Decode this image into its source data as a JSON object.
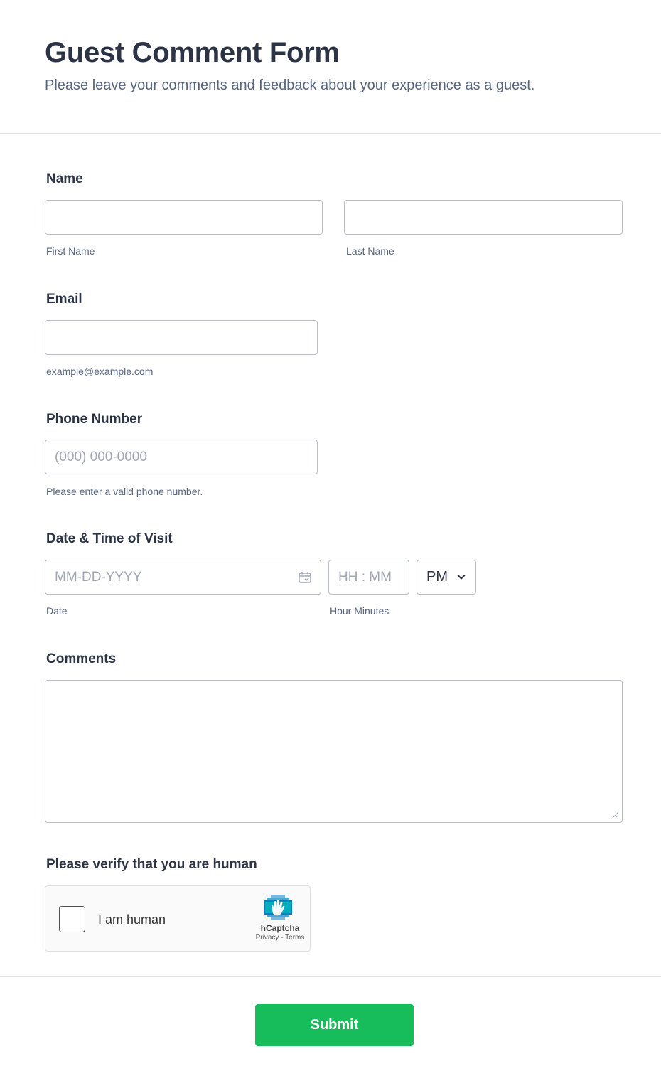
{
  "header": {
    "title": "Guest Comment Form",
    "subtitle": "Please leave your comments and feedback about your experience as a guest."
  },
  "name_field": {
    "label": "Name",
    "first": {
      "value": "",
      "sublabel": "First Name"
    },
    "last": {
      "value": "",
      "sublabel": "Last Name"
    }
  },
  "email_field": {
    "label": "Email",
    "value": "",
    "sublabel": "example@example.com"
  },
  "phone_field": {
    "label": "Phone Number",
    "value": "",
    "placeholder": "(000) 000-0000",
    "sublabel": "Please enter a valid phone number."
  },
  "visit_field": {
    "label": "Date & Time of Visit",
    "date_placeholder": "MM-DD-YYYY",
    "date_sublabel": "Date",
    "time_placeholder": "HH : MM",
    "time_sublabel": "Hour Minutes",
    "ampm_value": "PM",
    "calendar_icon": "calendar-icon",
    "dropdown_icon": "chevron-down-icon"
  },
  "comments_field": {
    "label": "Comments",
    "value": ""
  },
  "captcha": {
    "label": "Please verify that you are human",
    "checkbox_label": "I am human",
    "brand": "hCaptcha",
    "links": "Privacy - Terms",
    "checked": false
  },
  "submit": {
    "label": "Submit"
  },
  "colors": {
    "accent": "#18bd5b",
    "text": "#2c3345",
    "subtext": "#57647e",
    "border": "#b8bdc9"
  }
}
